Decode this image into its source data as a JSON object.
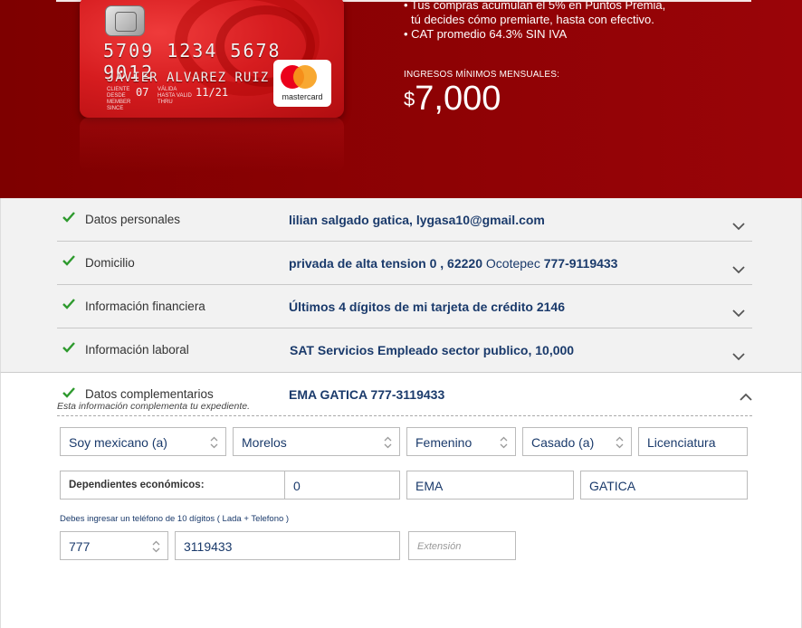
{
  "hero": {
    "card": {
      "number": "5709 1234 5678 9012",
      "holder": "JAVIER ALVAREZ RUIZ",
      "member_since_label": "CLIENTE DESDE MEMBER SINCE",
      "member_since": "07",
      "valid_label": "VÁLIDA HASTA VALID THRU",
      "expiry": "11/21",
      "brand": "mastercard"
    },
    "benefits": [
      "• Tus compras acumulan el 5% en Puntos Premia,",
      "  tú decides cómo premiarte, hasta con efectivo.",
      "• CAT promedio 64.3% SIN IVA"
    ],
    "income_label": "INGRESOS MÍNIMOS MENSUALES:",
    "income_currency": "$",
    "income_amount": "7,000"
  },
  "sections": [
    {
      "label": "Datos personales",
      "value": "lilian salgado gatica, lygasa10@gmail.com"
    },
    {
      "label": "Domicilio",
      "value_bold": "privada de alta tension 0 , 62220",
      "value_thin": " Ocotepec",
      "value_tail": " 777-9119433"
    },
    {
      "label": "Información financiera",
      "value": "Últimos 4 dígitos de mi tarjeta de crédito 2146"
    },
    {
      "label": "Información laboral",
      "value": "SAT Servicios Empleado sector publico, 10,000"
    }
  ],
  "open_section": {
    "label": "Datos complementarios",
    "value": "EMA GATICA 777-3119433",
    "note": "Esta información complementa tu expediente."
  },
  "form": {
    "nationality": "Soy mexicano (a)",
    "state": "Morelos",
    "gender": "Femenino",
    "marital_status": "Casado (a)",
    "education": "Licenciatura",
    "dependents_label": "Dependientes económicos:",
    "dependents": "0",
    "ref_name": "EMA",
    "ref_lastname": "GATICA",
    "phone_hint": "Debes ingresar un teléfono de 10 dígitos ( Lada + Telefono )",
    "lada": "777",
    "phone": "3119433",
    "extension_placeholder": "Extensión"
  },
  "colors": {
    "hero_red": "#8a0103",
    "check_green": "#2e9a2e",
    "value_blue": "#1a3a6b"
  }
}
